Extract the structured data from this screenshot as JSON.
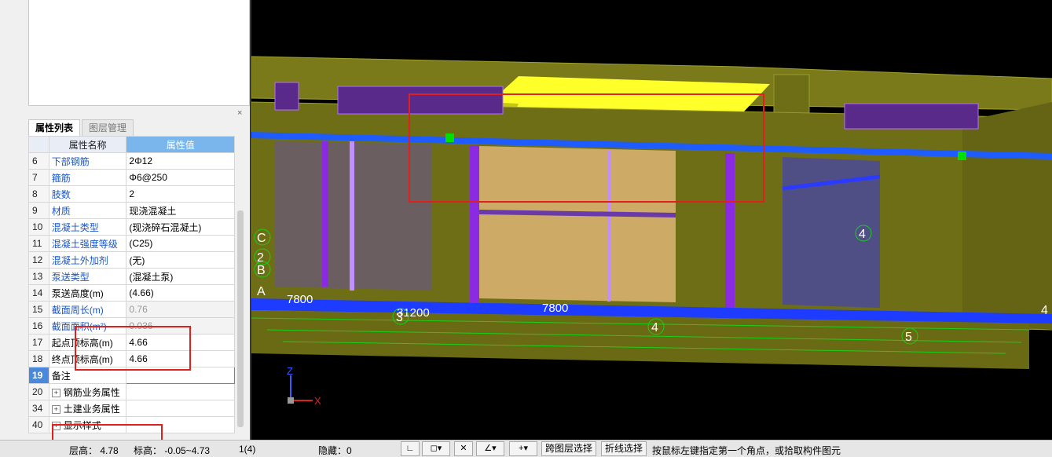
{
  "panel": {
    "close_icon": "×",
    "tabs": [
      {
        "label": "属性列表",
        "active": true
      },
      {
        "label": "图层管理",
        "active": false
      }
    ],
    "table_headers": {
      "name": "属性名称",
      "value": "属性值"
    },
    "rows": [
      {
        "num": "6",
        "name": "下部钢筋",
        "value": "2Φ12"
      },
      {
        "num": "7",
        "name": "箍筋",
        "value": "Φ6@250"
      },
      {
        "num": "8",
        "name": "肢数",
        "value": "2"
      },
      {
        "num": "9",
        "name": "材质",
        "value": "现浇混凝土"
      },
      {
        "num": "10",
        "name": "混凝土类型",
        "value": "(现浇碎石混凝土)"
      },
      {
        "num": "11",
        "name": "混凝土强度等级",
        "value": "(C25)"
      },
      {
        "num": "12",
        "name": "混凝土外加剂",
        "value": "(无)"
      },
      {
        "num": "13",
        "name": "泵送类型",
        "value": "(混凝土泵)"
      },
      {
        "num": "14",
        "name": "泵送高度(m)",
        "value": "(4.66)"
      },
      {
        "num": "15",
        "name": "截面周长(m)",
        "value": "0.76"
      },
      {
        "num": "16",
        "name": "截面面积(m²)",
        "value": "0.036"
      },
      {
        "num": "17",
        "name": "起点顶标高(m)",
        "value": "4.66"
      },
      {
        "num": "18",
        "name": "终点顶标高(m)",
        "value": "4.66"
      },
      {
        "num": "19",
        "name": "备注",
        "value": ""
      },
      {
        "num": "20",
        "name": "钢筋业务属性",
        "value": ""
      },
      {
        "num": "34",
        "name": "土建业务属性",
        "value": ""
      },
      {
        "num": "40",
        "name": "显示样式",
        "value": ""
      }
    ]
  },
  "viewport": {
    "axis_labels": {
      "x": "X",
      "z": "Z"
    },
    "grid_labels": [
      "C",
      "2",
      "B",
      "A",
      "3",
      "4",
      "5",
      "4",
      "4"
    ],
    "dimensions": [
      "7800",
      "7800",
      "31200",
      "7800"
    ]
  },
  "statusbar": {
    "floor_height": "层高：  4.78",
    "elevation": "标高：   -0.05~4.73",
    "count": "1(4)",
    "hidden": "隐藏：0",
    "cross_layer_button": "跨图层选择",
    "polyline_button": "折线选择",
    "hint": "按鼠标左键指定第一个角点，或拾取构件图元"
  },
  "colors": {
    "wall": "#6e6e16",
    "beam_blue": "#1e5cff",
    "column_purple": "#8a2be2",
    "highlight_red": "#e0201c",
    "selected_green": "#00e000"
  }
}
